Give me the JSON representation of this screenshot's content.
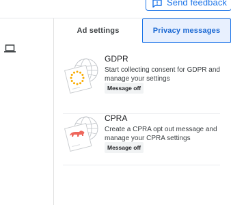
{
  "header": {
    "feedback_label": "Send feedback"
  },
  "tabs": [
    {
      "label": "Ad settings",
      "active": false
    },
    {
      "label": "Privacy messages",
      "active": true
    }
  ],
  "messages": [
    {
      "title": "GDPR",
      "description": "Start collecting consent for GDPR and manage your settings",
      "status": "Message off",
      "icon": "eu-stars-icon"
    },
    {
      "title": "CPRA",
      "description": "Create a CPRA opt out message and manage your CPRA settings",
      "status": "Message off",
      "icon": "california-bear-icon"
    }
  ],
  "colors": {
    "accent": "#1a73e8",
    "tab_active_bg": "#e8f0fe",
    "eu_star": "#f9ab00",
    "bear": "#ee675c"
  }
}
